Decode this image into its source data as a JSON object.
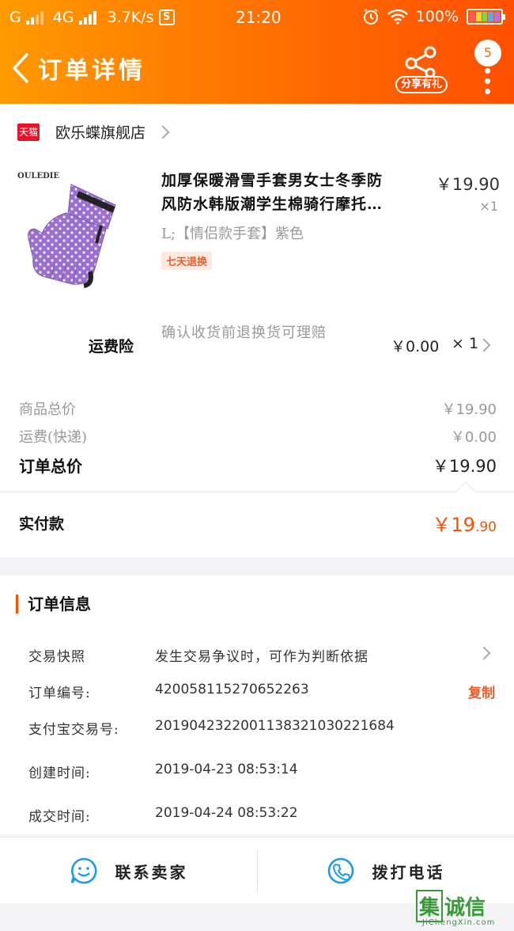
{
  "status_bar": {
    "carrier_1": "G",
    "carrier_2": "4G",
    "speed": "3.7K/s",
    "s_icon": "S",
    "time": "21:20",
    "battery": "100%",
    "icons": [
      "signal-icon",
      "alarm-icon",
      "wifi-icon",
      "battery-icon"
    ]
  },
  "nav": {
    "title": "订单详情",
    "share_label": "分享有礼",
    "badge_count": "5"
  },
  "shop": {
    "tag": "天猫",
    "name": "欧乐蝶旗舰店"
  },
  "product": {
    "brand": "OULEDIE",
    "title_line1": "加厚保暖滑雪手套男女士冬季防",
    "title_line2": "风防水韩版潮学生棉骑行摩托…",
    "price": "￥19.90",
    "qty": "×1",
    "sku": "L;【情侣款手套】紫色",
    "tag": "七天退换"
  },
  "insurance": {
    "name": "运费险",
    "desc": "确认收货前退换货可理赔",
    "price": "￥0.00",
    "qty": "× 1"
  },
  "summary": {
    "goods_label": "商品总价",
    "goods_value": "￥19.90",
    "shipping_label": "运费(快递)",
    "shipping_value": "￥0.00",
    "total_label": "订单总价",
    "total_value": "￥19.90",
    "paid_label": "实付款",
    "paid_symbol": "￥",
    "paid_int": "19",
    "paid_dec": ".90"
  },
  "order_info": {
    "title": "订单信息",
    "snapshot_label": "交易快照",
    "snapshot_value": "发生交易争议时，可作为判断依据",
    "order_no_label": "订单编号:",
    "order_no_value": "420058115270652263",
    "copy_label": "复制",
    "alipay_label": "支付宝交易号:",
    "alipay_value": "2019042322001138321030221684",
    "created_label": "创建时间:",
    "created_value": "2019-04-23 08:53:14",
    "deal_label": "成交时间:",
    "deal_value": "2019-04-24 08:53:22"
  },
  "bottom": {
    "contact_label": "联系卖家",
    "call_label": "拨打电话"
  },
  "watermark": {
    "text_box": "集",
    "text": "诚信",
    "sub": "JiChengXin.com"
  },
  "colors": {
    "accent": "#ff5000",
    "header_start": "#ff9a00",
    "header_end": "#ff5000",
    "product_purple": "#9b6fcf",
    "icon_blue": "#1e9be8"
  }
}
